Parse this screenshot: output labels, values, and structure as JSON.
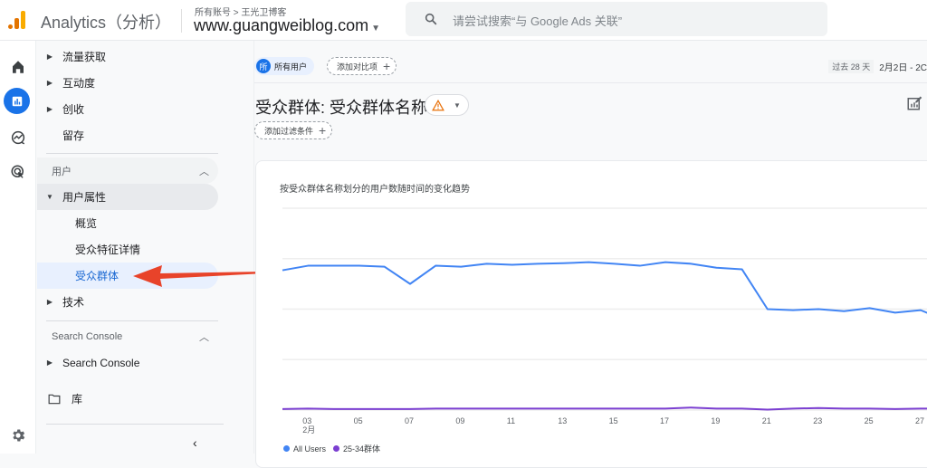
{
  "header": {
    "app_title": "Analytics（分析）",
    "breadcrumb": "所有账号 > 王光卫博客",
    "property": "www.guangweiblog.com",
    "search_placeholder": "请尝试搜索“与 Google Ads 关联”"
  },
  "rail": {
    "icons": [
      "home-icon",
      "reports-icon",
      "explore-icon",
      "advertising-icon"
    ],
    "settings_icon": "settings-icon"
  },
  "nav": {
    "items_top": [
      {
        "label": "流量获取",
        "expandable": true
      },
      {
        "label": "互动度",
        "expandable": true
      },
      {
        "label": "创收",
        "expandable": true
      },
      {
        "label": "留存",
        "expandable": false
      }
    ],
    "section_user": "用户",
    "user_attributes": "用户属性",
    "sub_items": [
      {
        "label": "概览",
        "active": false
      },
      {
        "label": "受众特征详情",
        "active": false
      },
      {
        "label": "受众群体",
        "active": true
      }
    ],
    "tech": "技术",
    "section_search_console": "Search Console",
    "search_console_item": "Search Console",
    "library": "库",
    "collapse_icon": "chevron-left-icon"
  },
  "main": {
    "segment_avatar": "所",
    "segment_label": "所有用户",
    "add_comparison": "添加对比项",
    "date_range_badge": "过去 28 天",
    "date_range": "2月2日 - 2C",
    "page_title": "受众群体: 受众群体名称",
    "add_filter": "添加过滤条件"
  },
  "colors": {
    "accent": "#1a73e8",
    "all_users": "#4285f4",
    "cohort": "#7b3fd1",
    "warning": "#e8710a",
    "annotation_arrow": "#e8432a"
  },
  "chart_data": {
    "type": "line",
    "title": "按受众群体名称划分的用户数随时间的变化趋势",
    "xlabel": "",
    "ylabel": "",
    "x": [
      2,
      3,
      4,
      5,
      6,
      7,
      8,
      9,
      10,
      11,
      12,
      13,
      14,
      15,
      16,
      17,
      18,
      19,
      20,
      21,
      22,
      23,
      24,
      25,
      26,
      27,
      28
    ],
    "x_tick_labels": [
      "03\n2月",
      "05",
      "07",
      "09",
      "11",
      "13",
      "15",
      "17",
      "19",
      "21",
      "23",
      "25",
      "27"
    ],
    "x_tick_values": [
      3,
      5,
      7,
      9,
      11,
      13,
      15,
      17,
      19,
      21,
      23,
      25,
      27
    ],
    "y_unit_note": "Y-axis labels not visible; values in gridline steps (baseline=0, top gridline=4)",
    "ylim": [
      0,
      4
    ],
    "grid": true,
    "legend_position": "bottom-left",
    "series": [
      {
        "name": "All Users",
        "color": "#4285f4",
        "values": [
          2.77,
          2.86,
          2.86,
          2.86,
          2.84,
          2.5,
          2.86,
          2.84,
          2.9,
          2.88,
          2.9,
          2.91,
          2.93,
          2.9,
          2.86,
          2.93,
          2.9,
          2.82,
          2.79,
          2.0,
          1.98,
          2.0,
          1.96,
          2.02,
          1.93,
          1.98,
          1.77
        ]
      },
      {
        "name": "25-34群体",
        "color": "#7b3fd1",
        "values": [
          0.02,
          0.03,
          0.02,
          0.02,
          0.02,
          0.02,
          0.03,
          0.03,
          0.03,
          0.03,
          0.03,
          0.03,
          0.03,
          0.03,
          0.03,
          0.03,
          0.05,
          0.03,
          0.03,
          0.01,
          0.03,
          0.04,
          0.03,
          0.03,
          0.02,
          0.03,
          0.03
        ]
      }
    ]
  }
}
